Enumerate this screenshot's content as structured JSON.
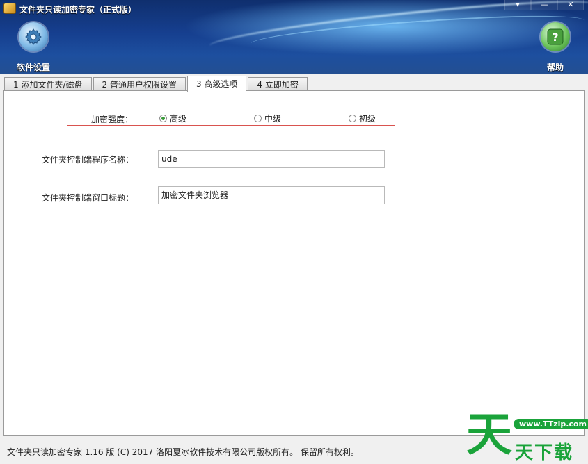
{
  "window": {
    "title": "文件夹只读加密专家（正式版）",
    "controls": [
      "▾",
      "—",
      "✕"
    ]
  },
  "toolbar": {
    "settings_label": "软件设置",
    "help_label": "帮助"
  },
  "tabs": [
    {
      "label": "1 添加文件夹/磁盘",
      "active": false
    },
    {
      "label": "2 普通用户权限设置",
      "active": false
    },
    {
      "label": "3 高级选项",
      "active": true
    },
    {
      "label": "4 立即加密",
      "active": false
    }
  ],
  "advanced": {
    "strength_label": "加密强度：",
    "strength_options": [
      {
        "label": "高级",
        "checked": true
      },
      {
        "label": "中级",
        "checked": false
      },
      {
        "label": "初级",
        "checked": false
      }
    ],
    "program_name_label": "文件夹控制端程序名称：",
    "program_name_value": "ude",
    "window_title_label": "文件夹控制端窗口标题：",
    "window_title_value": "加密文件夹浏览器"
  },
  "status": {
    "text": "文件夹只读加密专家 1.16 版 (C) 2017 洛阳夏冰软件技术有限公司版权所有。 保留所有权利。"
  },
  "watermark": {
    "glyph": "天",
    "url": "www.TTzip.com",
    "sub": "天下载"
  },
  "colors": {
    "accent_red": "#d9534f",
    "radio_green": "#3a9a3a",
    "watermark_green": "#1aa33a"
  }
}
